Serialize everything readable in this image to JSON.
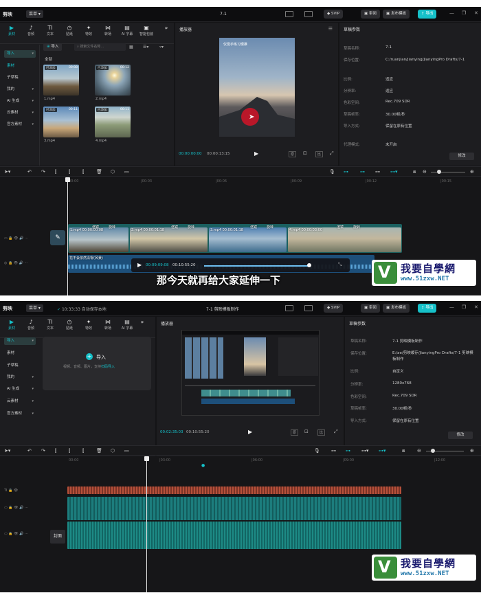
{
  "shot1": {
    "logo": "剪映",
    "menu": "菜单",
    "title": "7-1",
    "svip": "SVIP",
    "review": "审阅",
    "publish": "发布模板",
    "export": "导出",
    "tools": [
      {
        "label": "素材",
        "icon": "media-icon"
      },
      {
        "label": "音频",
        "icon": "audio-icon"
      },
      {
        "label": "文本",
        "icon": "text-icon"
      },
      {
        "label": "贴纸",
        "icon": "sticker-icon"
      },
      {
        "label": "特效",
        "icon": "effects-icon"
      },
      {
        "label": "转场",
        "icon": "transition-icon"
      },
      {
        "label": "AI 字幕",
        "icon": "ai-caption-icon"
      },
      {
        "label": "智能包装",
        "icon": "smart-pack-icon"
      }
    ],
    "side": [
      "导入",
      "素材",
      "子草稿",
      "我的",
      "AI 生成",
      "云素材",
      "官方素材"
    ],
    "import_btn": "导入",
    "search_placeholder": "搜索文件名称...",
    "all": "全部",
    "clips": [
      {
        "tag": "已添加",
        "dur": "00:08",
        "name": "1.mp4"
      },
      {
        "tag": "已添加",
        "dur": "00:12",
        "name": "2.mp4"
      },
      {
        "tag": "已添加",
        "dur": "00:11",
        "name": "3.mp4"
      },
      {
        "tag": "已添加",
        "dur": "00:11",
        "name": "4.mp4"
      }
    ],
    "player": {
      "title": "播放器",
      "cur": "00:00:00:00",
      "total": "00:00:13:15",
      "overlay_text": "仅需手练习慢推"
    },
    "props": {
      "title": "草稿参数",
      "rows": [
        [
          "草稿名称:",
          "7-1"
        ],
        [
          "保存位置:",
          "C:/ruanjian/jianying/JianyingPro Drafts/7-1"
        ],
        [
          "比例:",
          "适应"
        ],
        [
          "分辨率:",
          "适应"
        ],
        [
          "色彩空间:",
          "Rec.709 SDR"
        ],
        [
          "草稿帧率:",
          "30.00帧/秒"
        ],
        [
          "导入方式:",
          "保留在原有位置"
        ],
        [
          "代理模式:",
          "未开启"
        ]
      ],
      "edit": "修改"
    },
    "ruler": [
      "00:00",
      "|00:03",
      "|00:06",
      "|00:09",
      "|00:12",
      "|00:15"
    ],
    "video_clips": [
      "1.mp4  00:00:00:08",
      "2.mp4  00:00:01:18",
      "3.mp4  00:00:01:18",
      "4.mp4  00:00:03:00"
    ],
    "fx_labels": [
      "渲镜",
      "旋转",
      "渲镜",
      "旋转",
      "渲镜",
      "旋转",
      "渲镜",
      "旋转",
      "渲镜",
      "旋转"
    ],
    "audio_clip": "花不会依然清零(风景)",
    "ovl_cur": "00:09:09:08",
    "ovl_total": "00:10:55:20",
    "subtitle": "那今天就再给大家延伸一下"
  },
  "shot2": {
    "logo": "剪映",
    "menu": "菜单",
    "autosave": "10:33:33 自动保存本地",
    "title": "7-1 剪映模板制作",
    "svip": "SVIP",
    "review": "审阅",
    "publish": "发布模板",
    "export": "导出",
    "tools": [
      {
        "label": "素材",
        "icon": "media-icon"
      },
      {
        "label": "音频",
        "icon": "audio-icon"
      },
      {
        "label": "文本",
        "icon": "text-icon"
      },
      {
        "label": "贴纸",
        "icon": "sticker-icon"
      },
      {
        "label": "特效",
        "icon": "effects-icon"
      },
      {
        "label": "转场",
        "icon": "transition-icon"
      },
      {
        "label": "AI 字幕",
        "icon": "ai-caption-icon"
      }
    ],
    "side": [
      "导入",
      "素材",
      "子草稿",
      "我的",
      "AI 生成",
      "云素材",
      "官方素材"
    ],
    "import_label": "导入",
    "import_hint": "视频、音频、图片，支持",
    "import_link": "扫码导入",
    "player": {
      "title": "播放器",
      "cur": "00:02:35:03",
      "total": "00:10:55:20"
    },
    "props": {
      "title": "草稿参数",
      "rows": [
        [
          "草稿名称:",
          "7-1 剪映模板制作"
        ],
        [
          "保存位置:",
          "E:/ae/剪映缓存/JianyingPro Drafts/7-1 剪映模板制作"
        ],
        [
          "比例:",
          "自定义"
        ],
        [
          "分辨率:",
          "1280x768"
        ],
        [
          "色彩空间:",
          "Rec.709 SDR"
        ],
        [
          "草稿帧率:",
          "30.00帧/秒"
        ],
        [
          "导入方式:",
          "保留在原有位置"
        ]
      ],
      "edit": "修改"
    },
    "ruler": [
      "00:00",
      "|03:00",
      "|06:00",
      "|09:00",
      "|12:00"
    ],
    "cover": "封面"
  },
  "watermark": {
    "big": "我要自學網",
    "url": "www.51zxw.NET"
  },
  "colors": {
    "accent": "#16c1c9",
    "bg": "#141416",
    "panel": "#1d1d20"
  }
}
